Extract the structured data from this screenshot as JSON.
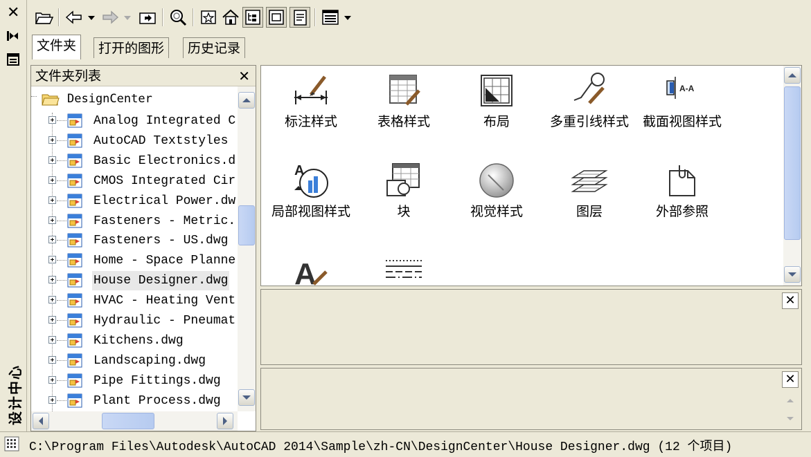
{
  "palette": {
    "title": "设计中心"
  },
  "toolbar": {
    "buttons": [
      "load-icon",
      "back-icon",
      "forward-icon",
      "up-icon",
      "search-icon",
      "favorites-icon",
      "home-icon",
      "tree-view-icon",
      "preview-icon",
      "description-icon",
      "views-icon"
    ]
  },
  "tabs": [
    {
      "label": "文件夹",
      "active": true
    },
    {
      "label": "打开的图形",
      "active": false
    },
    {
      "label": "历史记录",
      "active": false
    }
  ],
  "tree": {
    "title": "文件夹列表",
    "root": "DesignCenter",
    "items": [
      {
        "label": "Analog Integrated C"
      },
      {
        "label": "AutoCAD Textstyles"
      },
      {
        "label": "Basic Electronics.d"
      },
      {
        "label": "CMOS Integrated Cir"
      },
      {
        "label": "Electrical Power.dw"
      },
      {
        "label": "Fasteners - Metric."
      },
      {
        "label": "Fasteners - US.dwg"
      },
      {
        "label": "Home - Space Planne"
      },
      {
        "label": "House Designer.dwg",
        "selected": true
      },
      {
        "label": "HVAC - Heating Vent"
      },
      {
        "label": "Hydraulic - Pneumat"
      },
      {
        "label": "Kitchens.dwg"
      },
      {
        "label": "Landscaping.dwg"
      },
      {
        "label": "Pipe Fittings.dwg"
      },
      {
        "label": "Plant Process.dwg"
      }
    ]
  },
  "content": {
    "items": [
      {
        "label": "标注样式",
        "icon": "dimstyle-icon"
      },
      {
        "label": "表格样式",
        "icon": "tablestyle-icon"
      },
      {
        "label": "布局",
        "icon": "layout-icon"
      },
      {
        "label": "多重引线样式",
        "icon": "mleaderstyle-icon"
      },
      {
        "label": "截面视图样式",
        "icon": "sectionviewstyle-icon"
      },
      {
        "label": "局部视图样式",
        "icon": "detailviewstyle-icon"
      },
      {
        "label": "块",
        "icon": "block-icon"
      },
      {
        "label": "视觉样式",
        "icon": "visualstyle-icon"
      },
      {
        "label": "图层",
        "icon": "layers-icon"
      },
      {
        "label": "外部参照",
        "icon": "xref-icon"
      },
      {
        "label": "",
        "icon": "textstyle-icon"
      },
      {
        "label": "",
        "icon": "linetype-icon"
      }
    ]
  },
  "status": {
    "path": "C:\\Program Files\\Autodesk\\AutoCAD 2014\\Sample\\zh-CN\\DesignCenter\\House Designer.dwg (12 个项目)"
  }
}
